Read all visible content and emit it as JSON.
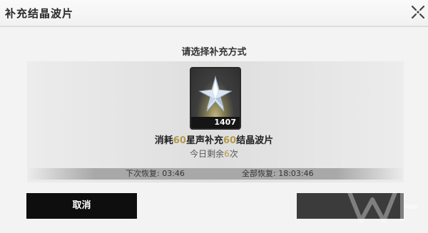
{
  "dialog": {
    "title": "补充结晶波片",
    "subtitle": "请选择补充方式"
  },
  "item": {
    "icon": "crystal-star-icon",
    "count": "1407"
  },
  "cost": {
    "prefix": "消耗",
    "amount": "60",
    "middle": "星声补充",
    "gain": "60",
    "suffix": "结晶波片"
  },
  "daily": {
    "prefix": "今日剩余",
    "remaining": "6",
    "suffix": "次"
  },
  "status": {
    "next_label": "下次恢复:",
    "next_time": "03:46",
    "all_label": "全部恢复:",
    "all_time": "18:03:46"
  },
  "buttons": {
    "cancel_label": "取消"
  },
  "colors": {
    "highlight": "#b59a4c",
    "cancel_bg": "#0e0e0e",
    "confirm_bg": "#3b3b3b"
  }
}
